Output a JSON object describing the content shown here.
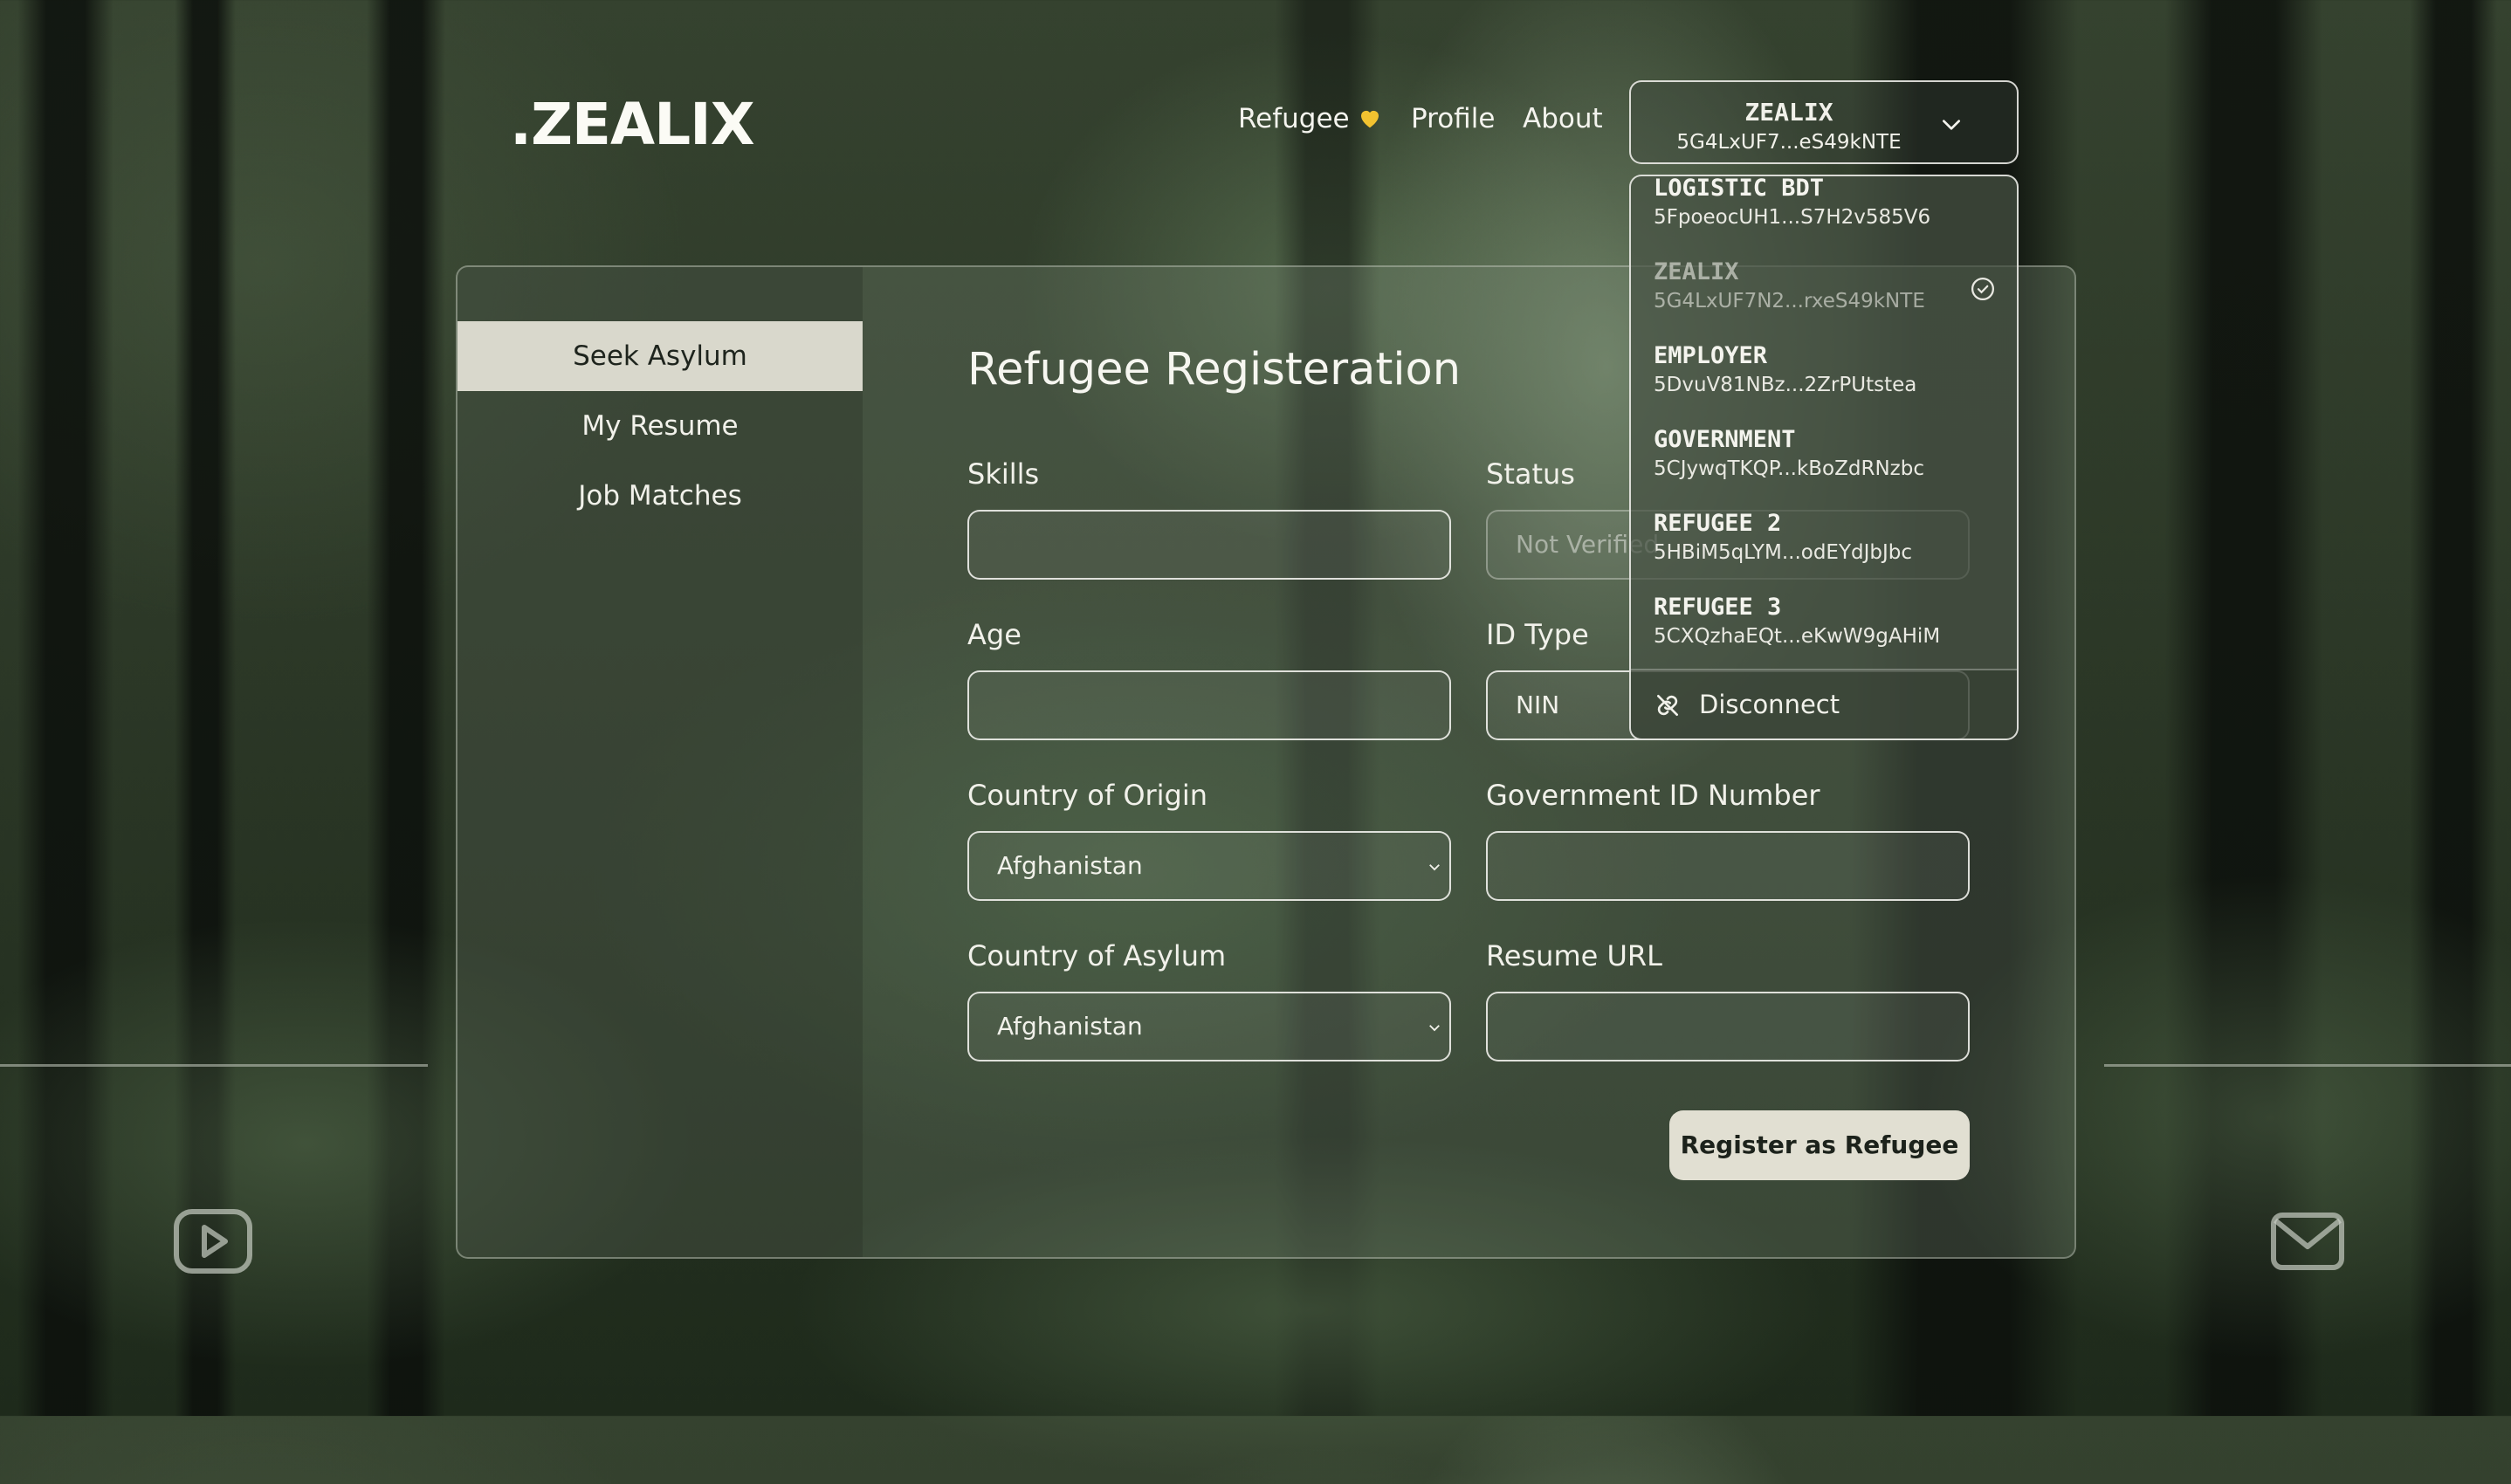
{
  "header": {
    "logo_text": ".ZEALIX",
    "nav": [
      {
        "label": "Refugee"
      },
      {
        "label": "Profile"
      },
      {
        "label": "About"
      }
    ],
    "wallet": {
      "name": "ZEALIX",
      "address": "5G4LxUF7...eS49kNTE"
    }
  },
  "dropdown": {
    "accounts": [
      {
        "name": "LOGISTIC BDT",
        "address": "5FpoeocUH1...S7H2v585V6"
      },
      {
        "name": "ZEALIX",
        "address": "5G4LxUF7N2...rxeS49kNTE",
        "selected": true
      },
      {
        "name": "EMPLOYER",
        "address": "5DvuV81NBz...2ZrPUtstea"
      },
      {
        "name": "GOVERNMENT",
        "address": "5CJywqTKQP...kBoZdRNzbc"
      },
      {
        "name": "REFUGEE 2",
        "address": "5HBiM5qLYM...odEYdJbJbc"
      },
      {
        "name": "REFUGEE 3",
        "address": "5CXQzhaEQt...eKwW9gAHiM"
      }
    ],
    "disconnect_label": "Disconnect"
  },
  "sidebar": {
    "items": [
      {
        "label": "Seek Asylum",
        "active": true
      },
      {
        "label": "My Resume"
      },
      {
        "label": "Job Matches"
      }
    ]
  },
  "form": {
    "title": "Refugee Registeration",
    "skills": {
      "label": "Skills",
      "value": ""
    },
    "status": {
      "label": "Status",
      "value": "Not Verified"
    },
    "age": {
      "label": "Age",
      "value": ""
    },
    "id_type": {
      "label": "ID Type",
      "value": "NIN"
    },
    "country_origin": {
      "label": "Country of Origin",
      "value": "Afghanistan"
    },
    "gov_id": {
      "label": "Government ID Number",
      "value": ""
    },
    "country_asylum": {
      "label": "Country of Asylum",
      "value": "Afghanistan"
    },
    "resume_url": {
      "label": "Resume URL",
      "value": ""
    },
    "submit_label": "Register as Refugee"
  },
  "icons": {
    "heart": "yellow-heart",
    "youtube": "youtube-icon",
    "mail": "mail-icon",
    "disconnect": "unlink-icon"
  },
  "colors": {
    "accent": "#e1dfd2",
    "heart": "#f2c230"
  }
}
